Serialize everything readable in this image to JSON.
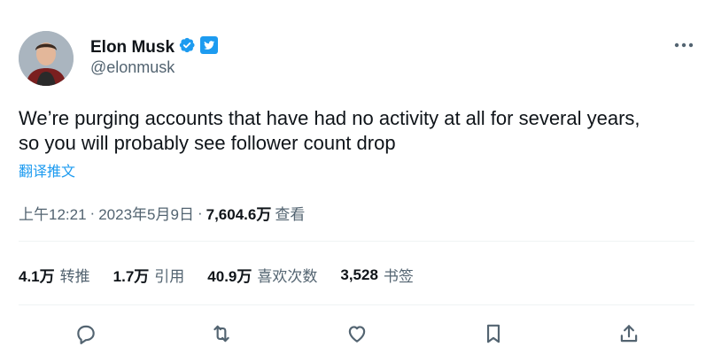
{
  "author": {
    "name": "Elon Musk",
    "handle": "@elonmusk"
  },
  "tweet": {
    "text_line1": "We’re purging accounts that have had no activity at all for several years,",
    "text_line2": "so you will probably see follower count drop",
    "translate_label": "翻译推文"
  },
  "meta": {
    "time": "上午12:21",
    "separator1": "·",
    "date": "2023年5月9日",
    "separator2": "·",
    "views_count": "7,604.6万",
    "views_label": "查看"
  },
  "stats": [
    {
      "count": "4.1万",
      "label": "转推"
    },
    {
      "count": "1.7万",
      "label": "引用"
    },
    {
      "count": "40.9万",
      "label": "喜欢次数"
    },
    {
      "count": "3,528",
      "label": "书签"
    }
  ],
  "icons": {
    "verified": "verified-badge-icon",
    "twitter_logo": "twitter-bird-icon",
    "more": "more-icon",
    "reply": "reply-icon",
    "retweet": "retweet-icon",
    "like": "heart-icon",
    "bookmark": "bookmark-icon",
    "share": "share-icon"
  },
  "colors": {
    "accent": "#1d9bf0",
    "text": "#0f1419",
    "secondary": "#536471"
  }
}
